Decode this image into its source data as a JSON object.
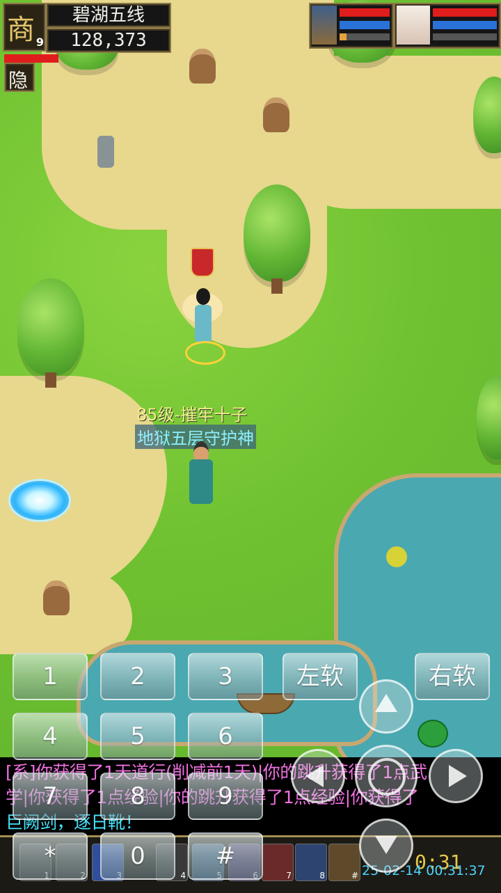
{
  "location": {
    "map_name": "碧湖五线",
    "currency": "128,373",
    "level_badge": "9",
    "icon_char": "商",
    "hide_label": "隐"
  },
  "npc": {
    "title": "85级-摧牢十子",
    "subtitle": "地狱五层守护神"
  },
  "keypad": {
    "keys": [
      "1",
      "2",
      "3",
      "4",
      "5",
      "6",
      "7",
      "8",
      "9",
      "*",
      "0",
      "#"
    ],
    "left_soft": "左软",
    "right_soft": "右软"
  },
  "chat": {
    "line1": "[系]你获得了1天道行(削减前1天)|你的跳升获得了1点武",
    "line2": "学|你获得了1点经验|你的跳升获得了1点经验|你获得了",
    "line3": "巨阙剑，逐日靴！"
  },
  "hud": {
    "timer": "0:31",
    "datetime": "25-02-14 00:31:37",
    "skill_slot_numbers": [
      "1",
      "2",
      "3",
      "4",
      "5",
      "6",
      "7",
      "8",
      "#"
    ],
    "colors": {
      "hp": "#e01d1d",
      "mp": "#2a72d8",
      "chat_pink": "#f070e0",
      "chat_cyan": "#47e6ff",
      "chat_yellow": "#f3f042"
    }
  }
}
